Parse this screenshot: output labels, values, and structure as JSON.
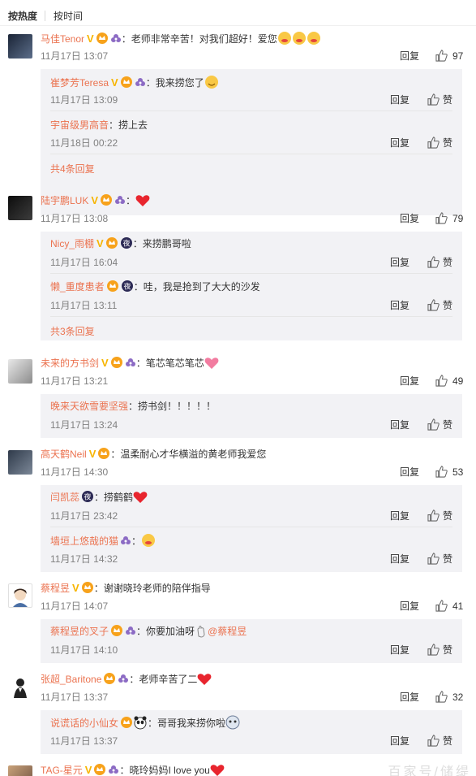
{
  "sort": {
    "hot": "按热度",
    "time": "按时间"
  },
  "reply_label": "回复",
  "like_label": "赞",
  "comments": [
    {
      "user": "马佳Tenor",
      "text": "老师非常辛苦！对我们超好！爱您",
      "time": "11月17日 13:07",
      "likes": "97",
      "replies": [
        {
          "user": "崔梦芳Teresa",
          "text": "我来捞您了",
          "time": "11月17日 13:09"
        },
        {
          "user": "宇宙级男高音",
          "text": "捞上去",
          "time": "11月18日 00:22"
        }
      ],
      "more": "共4条回复"
    },
    {
      "user": "陆宇鹏LUK",
      "text": "",
      "time": "11月17日 13:08",
      "likes": "79",
      "replies": [
        {
          "user": "Nicy_雨棚",
          "text": "来捞鹏哥啦",
          "time": "11月17日 16:04"
        },
        {
          "user": "懒_重度患者",
          "text": "哇，我是抢到了大大的沙发",
          "time": "11月17日 13:11"
        }
      ],
      "more": "共3条回复"
    },
    {
      "user": "未来的方书剑",
      "text": "笔芯笔芯笔芯",
      "time": "11月17日 13:21",
      "likes": "49",
      "replies": [
        {
          "user": "晚来天欲雪要坚强",
          "text": "捞书剑！！！！！",
          "time": "11月17日 13:24"
        }
      ]
    },
    {
      "user": "高天鹤Neil",
      "text": "温柔耐心才华横溢的黄老师我爱您",
      "time": "11月17日 14:30",
      "likes": "53",
      "replies": [
        {
          "user": "闫凯蕊",
          "text": "捞鹤鹤",
          "time": "11月17日 23:42"
        },
        {
          "user": "墙垣上悠哉的猫",
          "text": "",
          "time": "11月17日 14:32"
        }
      ]
    },
    {
      "user": "蔡程昱",
      "text": "谢谢晓玲老师的陪伴指导",
      "time": "11月17日 14:07",
      "likes": "41",
      "replies": [
        {
          "user": "蔡程昱的叉子",
          "text": "你要加油呀",
          "mention": "@蔡程昱",
          "time": "11月17日 14:10"
        }
      ]
    },
    {
      "user": "张超_Baritone",
      "text": "老师辛苦了二",
      "time": "11月17日 13:37",
      "likes": "32",
      "replies": [
        {
          "user": "说谎话的小仙女",
          "text": "哥哥我来捞你啦",
          "time": "11月17日 13:37"
        }
      ]
    },
    {
      "user": "TAG-星元",
      "text": "晓玲妈妈I love you"
    }
  ],
  "watermark": "百家号/储缇",
  "colors": {
    "username": "#eb7350",
    "reply_bg": "#f2f2f5",
    "meta": "#808080",
    "vip_badge": "#f7b500"
  },
  "icons": [
    "thumbs-up-icon",
    "verified-v-icon",
    "vip-crown-icon",
    "flower-badge-icon",
    "night-badge-icon",
    "heart-emoji",
    "laugh-emoji"
  ]
}
